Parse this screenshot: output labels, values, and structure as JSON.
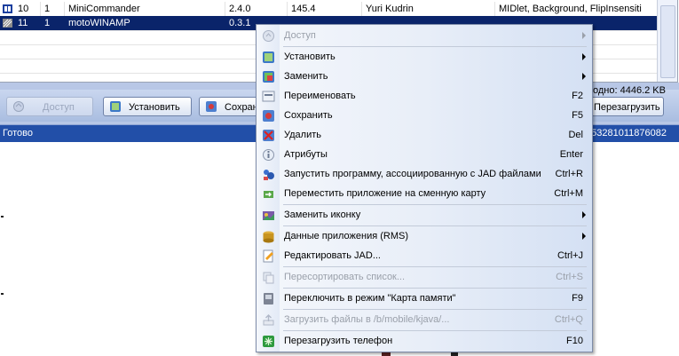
{
  "table": {
    "rows": [
      {
        "num": "10",
        "flag": "1",
        "name": "MiniCommander",
        "version": "2.4.0",
        "size": "145.4",
        "vendor": "Yuri Kudrin",
        "props": "MIDlet, Background, FlipInsensiti"
      },
      {
        "num": "11",
        "flag": "1",
        "name": "motoWINAMP",
        "version": "0.3.1",
        "size": "",
        "vendor": "",
        "props": ""
      }
    ]
  },
  "toolbar": {
    "access_label": "Доступ",
    "install_label": "Установить",
    "save_label": "Сохран",
    "free_info": "одно: 4446.2 KB",
    "reboot_label": "Перезагрузить"
  },
  "status": {
    "text": "Готово",
    "device_id": "53281011876082"
  },
  "menu": {
    "items": [
      {
        "label": "Доступ",
        "shortcut": "",
        "submenu": true,
        "disabled": true,
        "icon": "access-icon"
      },
      {
        "label": "Установить",
        "shortcut": "",
        "submenu": true,
        "disabled": false,
        "icon": "install-icon"
      },
      {
        "label": "Заменить",
        "shortcut": "",
        "submenu": true,
        "disabled": false,
        "icon": "replace-icon"
      },
      {
        "label": "Переименовать",
        "shortcut": "F2",
        "submenu": false,
        "disabled": false,
        "icon": "rename-icon"
      },
      {
        "label": "Сохранить",
        "shortcut": "F5",
        "submenu": false,
        "disabled": false,
        "icon": "save-icon"
      },
      {
        "label": "Удалить",
        "shortcut": "Del",
        "submenu": false,
        "disabled": false,
        "icon": "delete-icon"
      },
      {
        "label": "Атрибуты",
        "shortcut": "Enter",
        "submenu": false,
        "disabled": false,
        "icon": "attributes-icon"
      },
      {
        "label": "Запустить программу, ассоциированную с JAD файлами",
        "shortcut": "Ctrl+R",
        "submenu": false,
        "disabled": false,
        "icon": "run-icon"
      },
      {
        "label": "Переместить приложение на сменную карту",
        "shortcut": "Ctrl+M",
        "submenu": false,
        "disabled": false,
        "icon": "move-to-card-icon"
      },
      {
        "label": "Заменить иконку",
        "shortcut": "",
        "submenu": true,
        "disabled": false,
        "icon": "replace-icon-icon"
      },
      {
        "label": "Данные приложения (RMS)",
        "shortcut": "",
        "submenu": true,
        "disabled": false,
        "icon": "rms-data-icon"
      },
      {
        "label": "Редактировать JAD...",
        "shortcut": "Ctrl+J",
        "submenu": false,
        "disabled": false,
        "icon": "edit-jad-icon"
      },
      {
        "label": "Пересортировать список...",
        "shortcut": "Ctrl+S",
        "submenu": false,
        "disabled": true,
        "icon": "resort-icon"
      },
      {
        "label": "Переключить в режим \"Карта памяти\"",
        "shortcut": "F9",
        "submenu": false,
        "disabled": false,
        "icon": "memory-card-icon"
      },
      {
        "label": "Загрузить файлы в /b/mobile/kjava/...",
        "shortcut": "Ctrl+Q",
        "submenu": false,
        "disabled": true,
        "icon": "upload-icon"
      },
      {
        "label": "Перезагрузить телефон",
        "shortcut": "F10",
        "submenu": false,
        "disabled": false,
        "icon": "reboot-phone-icon"
      }
    ]
  },
  "colors": {
    "selection": "#0a246a",
    "status_bar": "#224fa8",
    "toolbar": "#b8c7e6"
  }
}
